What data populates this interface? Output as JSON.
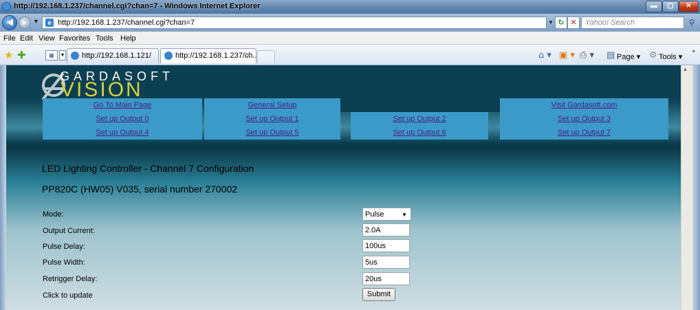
{
  "window": {
    "title": "http://192.168.1.237/channel.cgi?chan=7 - Windows Internet Explorer"
  },
  "address": {
    "url": "http://192.168.1.237/channel.cgi?chan=7"
  },
  "search": {
    "placeholder": "Yahoo! Search"
  },
  "menu": [
    "File",
    "Edit",
    "View",
    "Favorites",
    "Tools",
    "Help"
  ],
  "tabs": [
    {
      "label": "http://192.168.1.121/"
    },
    {
      "label": "http://192.168.1.237/ch..."
    }
  ],
  "commands": {
    "page": "Page",
    "tools": "Tools"
  },
  "logo": {
    "top": "GARDASOFT",
    "bottom": "VISION"
  },
  "nav": {
    "main": "Go To Main Page",
    "general": "General Setup",
    "visit": "Visit Gardasoft.com",
    "out0": "Set up Output 0",
    "out1": "Set up Output 1",
    "out2": "Set up Output 2",
    "out3": "Set up Output 3",
    "out4": "Set up Output 4",
    "out5": "Set up Output 5",
    "out6": "Set up Output 6",
    "out7": "Set up Output 7"
  },
  "page": {
    "title": "LED Lighting Controller - Channel 7 Configuration",
    "device": "PP820C (HW05) V035, serial number 270002"
  },
  "form": {
    "mode": {
      "label": "Mode:",
      "value": "Pulse"
    },
    "current": {
      "label": "Output Current:",
      "value": "2.0A"
    },
    "delay": {
      "label": "Pulse Delay:",
      "value": "100us"
    },
    "width": {
      "label": "Pulse Width:",
      "value": "5us"
    },
    "retrigger": {
      "label": "Retrigger Delay:",
      "value": "20us"
    },
    "update": {
      "label": "Click to update",
      "button": "Submit"
    }
  },
  "colors": {
    "nav_cell": "#3c9ac8",
    "nav_link": "#4a1d86",
    "logo_accent": "#d6d13c",
    "page_bg_dark": "#0d3f52"
  }
}
